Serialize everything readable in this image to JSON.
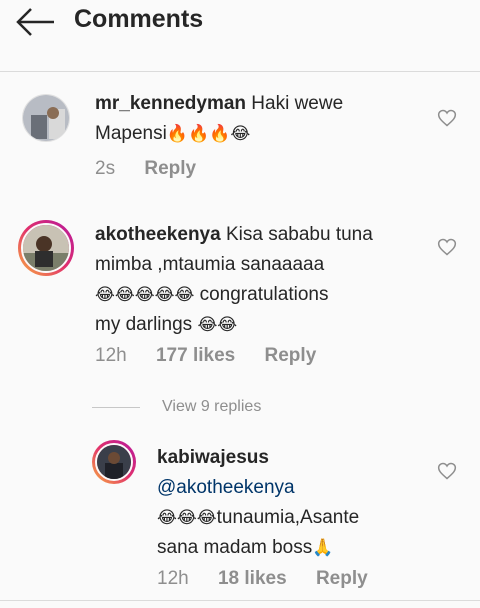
{
  "header": {
    "title": "Comments"
  },
  "comments": [
    {
      "username": "mr_kennedyman",
      "text_line1": "Haki wewe",
      "text_line2": "Mapensi",
      "emoji_line2": "🔥🔥🔥😂",
      "time": "2s",
      "reply_label": "Reply"
    },
    {
      "username": "akotheekenya",
      "text_line1": "Kisa sababu tuna",
      "text_line2": "mimba ,mtaumia sanaaaaa",
      "emoji_line3": "😂😂😂😂😂",
      "text_line3": "congratulations",
      "text_line4": "my darlings",
      "emoji_line4": "😂😂",
      "time": "12h",
      "likes": "177 likes",
      "reply_label": "Reply"
    }
  ],
  "view_replies": "View 9 replies",
  "reply": {
    "username": "kabiwajesus",
    "mention": "@akotheekenya",
    "emoji_line": "😂😂😂",
    "text_line1": "tunaumia,Asante",
    "text_line2": "sana madam boss",
    "emoji_end": "🙏",
    "time": "12h",
    "likes": "18 likes",
    "reply_label": "Reply"
  }
}
